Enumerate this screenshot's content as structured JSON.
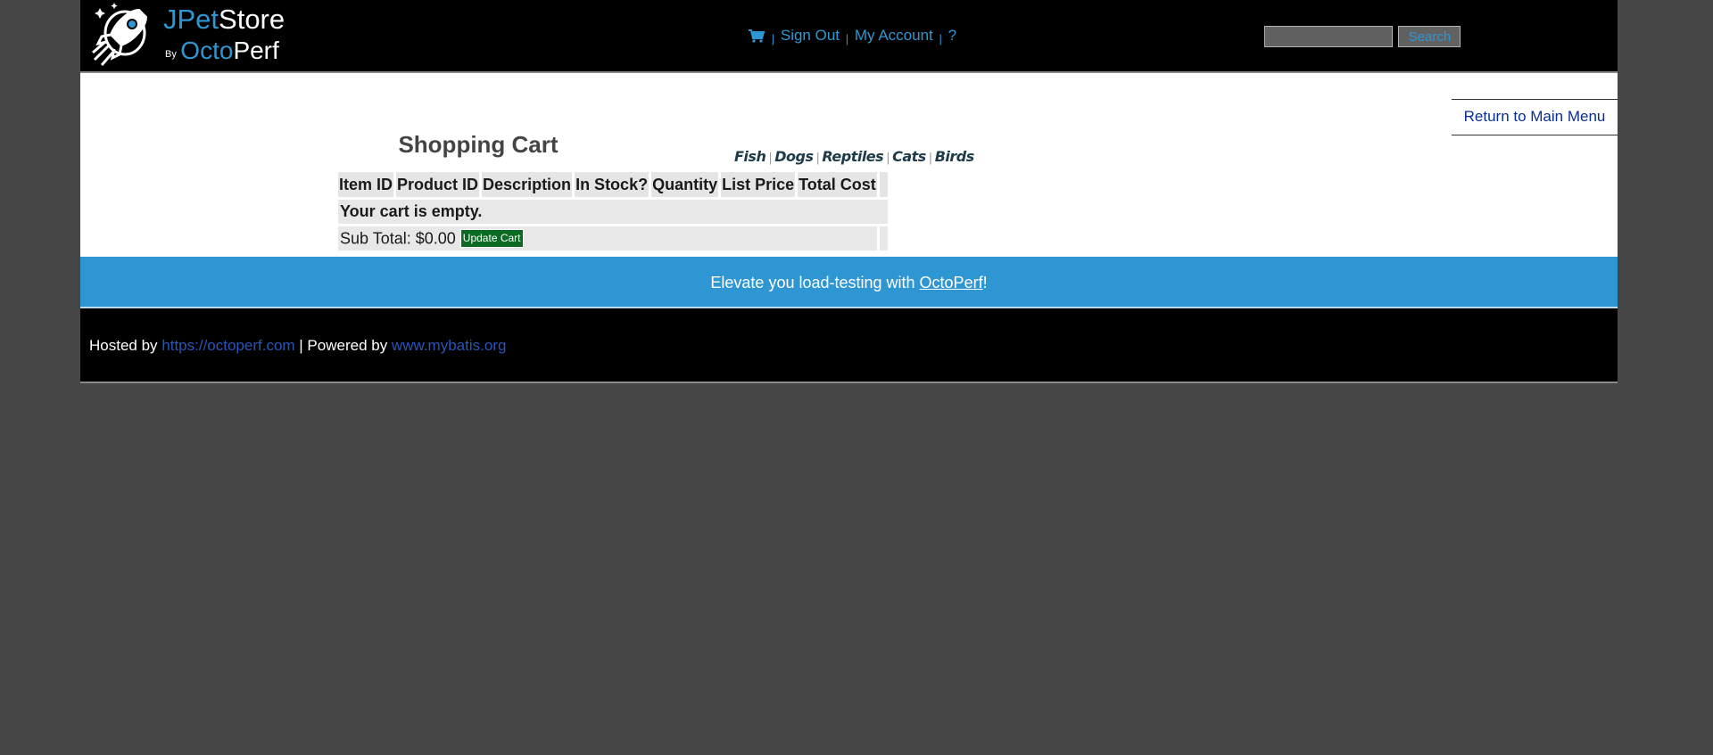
{
  "header": {
    "logo": {
      "brand_part1": "JPet",
      "brand_part2": "Store",
      "by": "By",
      "company_part1": "Octo",
      "company_part2": "Perf"
    },
    "menu": {
      "sign_out": "Sign Out",
      "my_account": "My Account",
      "help": "?",
      "separator": "|"
    },
    "search": {
      "value": "",
      "button_label": "Search"
    }
  },
  "quicklinks": [
    "Fish",
    "Dogs",
    "Reptiles",
    "Cats",
    "Birds"
  ],
  "back_link": "Return to Main Menu",
  "cart": {
    "title": "Shopping Cart",
    "columns": [
      "Item ID",
      "Product ID",
      "Description",
      "In Stock?",
      "Quantity",
      "List Price",
      "Total Cost"
    ],
    "empty_message": "Your cart is empty.",
    "subtotal_label": "Sub Total: $0.00",
    "update_button": "Update Cart"
  },
  "banner": {
    "text_before": "Elevate you load-testing with ",
    "link": "OctoPerf",
    "text_after": "!"
  },
  "footer": {
    "hosted_by": "Hosted by ",
    "hosted_link": "https://octoperf.com",
    "powered_by": " | Powered by ",
    "powered_link": "www.mybatis.org"
  },
  "colors": {
    "background": "#464646",
    "header": "#000000",
    "accent": "#2e97d3",
    "update_button": "#0b6b23",
    "link_dark": "#0b2f8f"
  }
}
